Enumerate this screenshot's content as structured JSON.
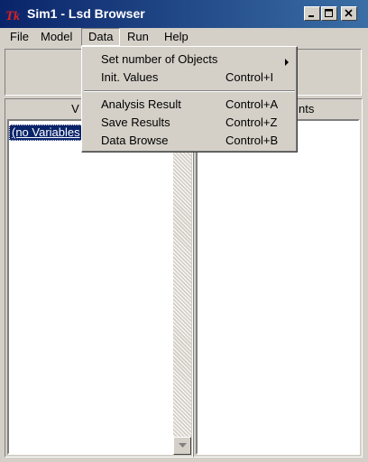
{
  "window": {
    "title": "Sim1 - Lsd Browser",
    "app_icon_text": "Tk",
    "controls": [
      "minimize-icon",
      "maximize-icon",
      "close-icon"
    ]
  },
  "menubar": {
    "file": "File",
    "model": "Model",
    "data": "Data",
    "run": "Run",
    "help": "Help"
  },
  "panels": {
    "variables_header": "Variables",
    "variables_header_visible": "V",
    "variables_items": [
      "(no Variables)"
    ],
    "variables_item_visible": "(no Variables",
    "elements_header": "Elements",
    "elements_header_visible": "nts"
  },
  "data_menu": {
    "items": [
      {
        "label": "Set number of Objects",
        "accel": "",
        "submenu": true
      },
      {
        "label": "Init. Values",
        "accel": "Control+I"
      },
      {
        "separator": true
      },
      {
        "label": "Analysis Result",
        "accel": "Control+A"
      },
      {
        "label": "Save Results",
        "accel": "Control+Z"
      },
      {
        "label": "Data Browse",
        "accel": "Control+B"
      }
    ]
  },
  "colors": {
    "titlebar_start": "#0a246a",
    "titlebar_end": "#3a6ea5",
    "face": "#d4d0c8",
    "selection": "#0a246a"
  }
}
